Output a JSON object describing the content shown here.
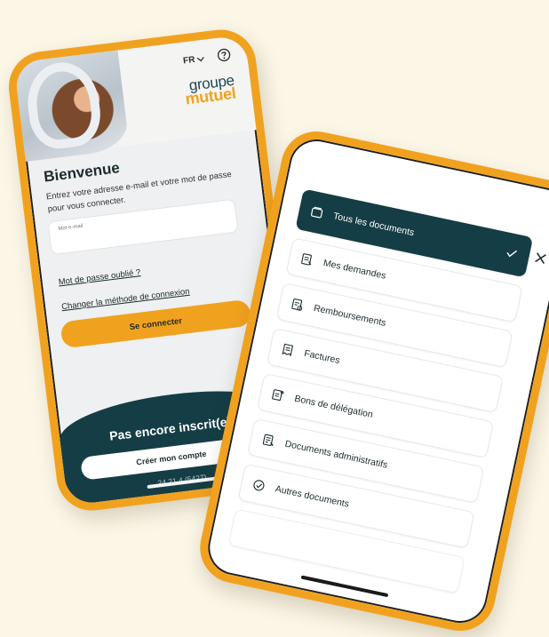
{
  "colors": {
    "accent": "#f0a21f",
    "dark_teal": "#153d45",
    "background": "#fbf6e6"
  },
  "login": {
    "language": "FR",
    "brand_line1": "groupe",
    "brand_line2": "mutuel",
    "title": "Bienvenue",
    "intro": "Entrez votre adresse e-mail et votre mot de passe pour vous connecter.",
    "email_label": "Mot e-mail",
    "forgot_password": "Mot de passe oublié ?",
    "change_method": "Changer la méthode de connexion",
    "connect_button": "Se connecter",
    "not_registered": "Pas encore inscrit(e) ?",
    "create_account_button": "Créer mon compte",
    "version": "24.21.4 (5427)"
  },
  "documents": {
    "items": [
      {
        "label": "Tous les documents",
        "icon": "folder-icon",
        "active": true
      },
      {
        "label": "Mes demandes",
        "icon": "request-icon",
        "active": false
      },
      {
        "label": "Remboursements",
        "icon": "refund-icon",
        "active": false
      },
      {
        "label": "Factures",
        "icon": "invoice-icon",
        "active": false
      },
      {
        "label": "Bons de délégation",
        "icon": "delegation-icon",
        "active": false
      },
      {
        "label": "Documents administratifs",
        "icon": "admin-doc-icon",
        "active": false
      },
      {
        "label": "Autres documents",
        "icon": "other-doc-icon",
        "active": false
      }
    ]
  }
}
